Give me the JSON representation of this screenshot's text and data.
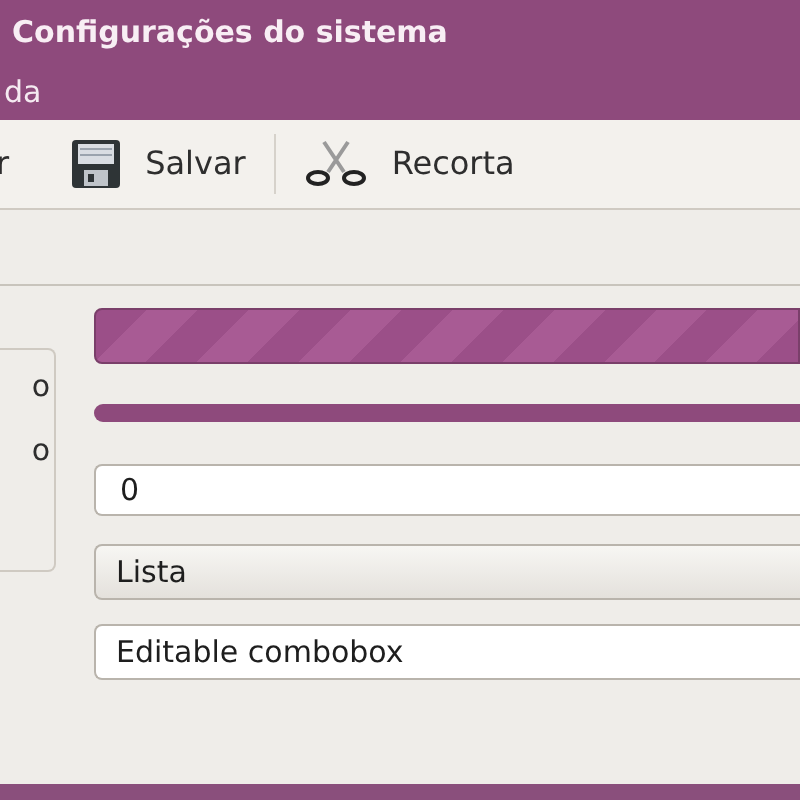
{
  "window": {
    "title": "Configurações do sistema"
  },
  "menu": [
    {
      "label": "da"
    }
  ],
  "toolbar": [
    {
      "kind": "text",
      "label": "r"
    },
    {
      "kind": "save",
      "label": "Salvar"
    },
    {
      "kind": "separator"
    },
    {
      "kind": "cut",
      "label": "Recorta"
    }
  ],
  "side_labels": [
    "o",
    "o"
  ],
  "progress_bars": [
    {
      "kind": "thick",
      "level": 1
    },
    {
      "kind": "thin",
      "level": 1
    }
  ],
  "fields": [
    {
      "kind": "spin",
      "value": "0"
    },
    {
      "kind": "dropdown",
      "value": "Lista"
    },
    {
      "kind": "combo",
      "value": "Editable combobox"
    }
  ]
}
